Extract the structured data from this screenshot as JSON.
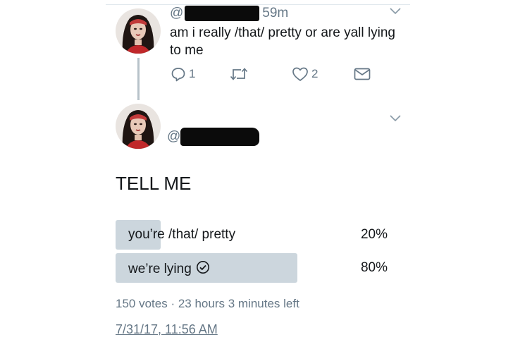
{
  "reply_tweet": {
    "handle_prefix": "@",
    "time": "59m",
    "text": "am i really /that/ pretty or are yall lying to me",
    "reply_count": "1",
    "like_count": "2"
  },
  "main_tweet": {
    "handle_prefix": "@",
    "text": "TELL ME",
    "poll": {
      "options": [
        {
          "label": "you’re /that/ pretty",
          "percent": "20%",
          "fraction": 0.2,
          "selected": false
        },
        {
          "label": "we’re lying",
          "percent": "80%",
          "fraction": 0.8,
          "selected": true
        }
      ],
      "meta": "150 votes · 23 hours 3 minutes left"
    },
    "timestamp": "7/31/17, 11:56 AM"
  },
  "colors": {
    "bar": "#ccd6dd",
    "muted": "#657786",
    "text": "#14171a"
  },
  "icons": [
    "chevron-down-icon",
    "reply-icon",
    "retweet-icon",
    "like-icon",
    "dm-icon",
    "check-circle-icon"
  ]
}
